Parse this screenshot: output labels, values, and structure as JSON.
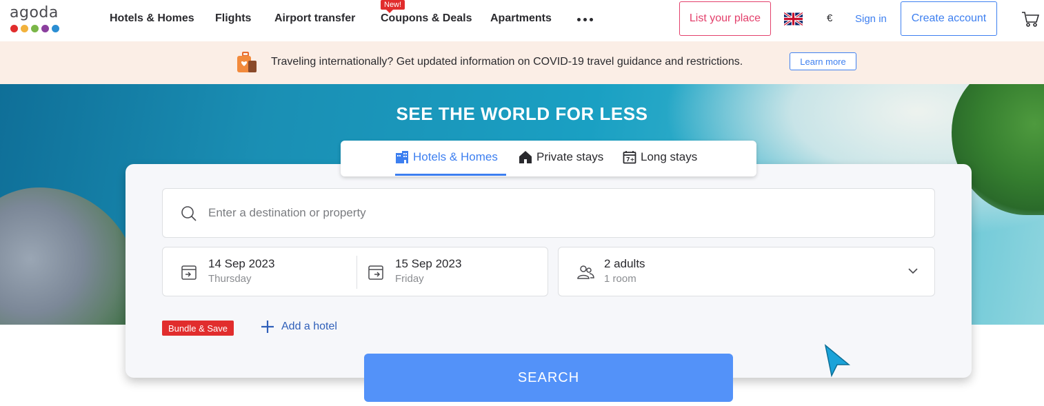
{
  "brand": {
    "name": "agoda",
    "dot_colors": [
      "#e12d2d",
      "#f2b23c",
      "#7ab648",
      "#8b3f9e",
      "#2b8ed3"
    ]
  },
  "nav": {
    "items": [
      {
        "label": "Hotels & Homes"
      },
      {
        "label": "Flights"
      },
      {
        "label": "Airport transfer"
      },
      {
        "label": "Coupons & Deals",
        "badge": "New!"
      },
      {
        "label": "Apartments"
      }
    ],
    "more_icon": "more-dots-icon"
  },
  "header_actions": {
    "list_place": "List your place",
    "language_flag": "uk-flag-icon",
    "currency": "€",
    "sign_in": "Sign in",
    "create_account": "Create account",
    "cart_icon": "cart-icon"
  },
  "banner": {
    "text": "Traveling internationally? Get updated information on COVID-19 travel guidance and restrictions.",
    "learn_more": "Learn more",
    "icon": "luggage-heart-icon"
  },
  "hero": {
    "title": "SEE THE WORLD FOR LESS"
  },
  "search": {
    "tabs": [
      {
        "label": "Hotels & Homes",
        "icon": "hotel-building-icon",
        "active": true
      },
      {
        "label": "Private stays",
        "icon": "house-icon",
        "active": false
      },
      {
        "label": "Long stays",
        "icon": "calendar-7-icon",
        "active": false
      }
    ],
    "destination_placeholder": "Enter a destination or property",
    "check_in": {
      "date": "14 Sep 2023",
      "day": "Thursday"
    },
    "check_out": {
      "date": "15 Sep 2023",
      "day": "Friday"
    },
    "guests": {
      "adults": "2 adults",
      "rooms": "1 room"
    },
    "bundle_badge": "Bundle & Save",
    "add_hotel": "Add a hotel",
    "search_button": "SEARCH"
  },
  "colors": {
    "accent_blue": "#3d7ff0",
    "search_button": "#5392f9",
    "list_place_pink": "#e33f6b",
    "badge_red": "#e12d2d",
    "banner_bg": "#fbeee6"
  }
}
